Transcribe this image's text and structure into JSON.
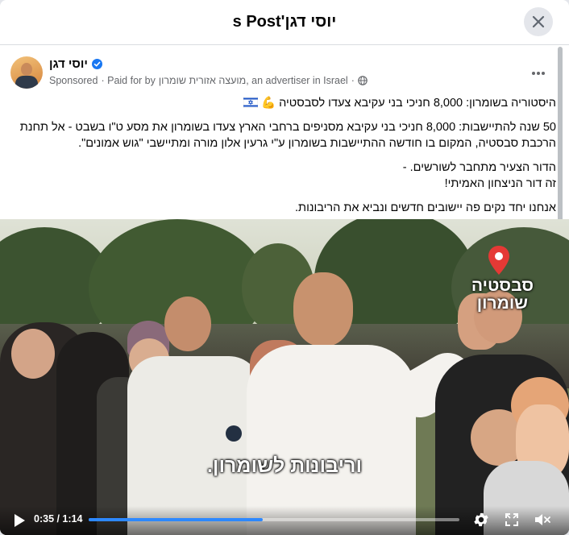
{
  "modal": {
    "title": "s Post'יוסי דגן",
    "close_icon": "close-icon"
  },
  "post": {
    "author": "יוסי דגן",
    "sponsored": "Sponsored",
    "paid_by_prefix": "· Paid for by",
    "advertiser": "מועצה אזורית שומרון, an advertiser in Israel",
    "dot": "·",
    "more_icon": "more-options-icon",
    "text": {
      "line1": "היסטוריה בשומרון: 8,000 חניכי בני עקיבא צעדו לסבסטיה 💪",
      "para2_line1": "50 שנה להתיישבות: 8,000 חניכי בני עקיבא מסניפים ברחבי הארץ צעדו בשומרון את מסע ט\"ו בשבט - אל תחנת",
      "para2_line2": "הרכבת סבסטיה, המקום בו חודשה ההתיישבות בשומרון ע\"י גרעין אלון מורה ומתיישבי \"גוש אמונים\".",
      "para3_line1": "הדור הצעיר מתחבר לשורשים. -",
      "para3_line2": "זה דור הניצחון האמיתי!",
      "para4": "אנחנו יחד נקים פה יישובים חדשים ונביא את הריבונות."
    }
  },
  "video": {
    "location_line1": "סבסטיה",
    "location_line2": "שומרון",
    "subtitle": "וריבונות לשומרון.",
    "time": "0:35 / 1:14",
    "progress": 0.47
  },
  "colors": {
    "accent": "#2d88ff",
    "verified": "#1877f2",
    "pin": "#e53935"
  }
}
